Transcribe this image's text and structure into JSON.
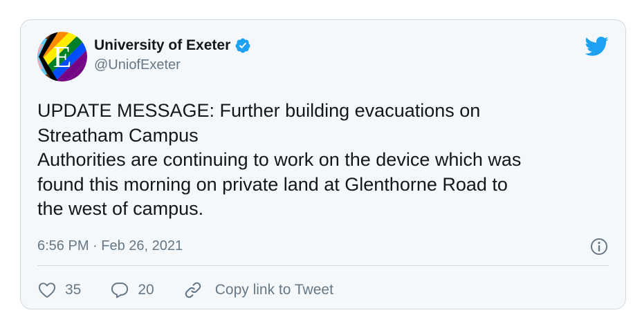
{
  "tweet": {
    "display_name": "University of Exeter",
    "handle": "@UniofExeter",
    "avatar_letter": "E",
    "verified": true,
    "text_lines": [
      "UPDATE MESSAGE: Further building evacuations on",
      "Streatham Campus",
      "Authorities are continuing to work on the device which was",
      "found this morning on private land at Glenthorne Road to",
      "the west of campus."
    ],
    "timestamp": "6:56 PM · Feb 26, 2021"
  },
  "actions": {
    "likes": "35",
    "replies": "20",
    "copy_link_label": "Copy link to Tweet"
  },
  "icons": {
    "brand": "twitter-bird-icon",
    "verified": "verified-badge-icon",
    "info": "info-icon",
    "like": "heart-icon",
    "reply": "reply-bubble-icon",
    "link": "link-icon"
  },
  "colors": {
    "twitter_blue": "#1da1f2",
    "card_background": "#f5f8fa",
    "border": "#cfd9de",
    "primary_text": "#14171a",
    "secondary_text": "#657786"
  }
}
